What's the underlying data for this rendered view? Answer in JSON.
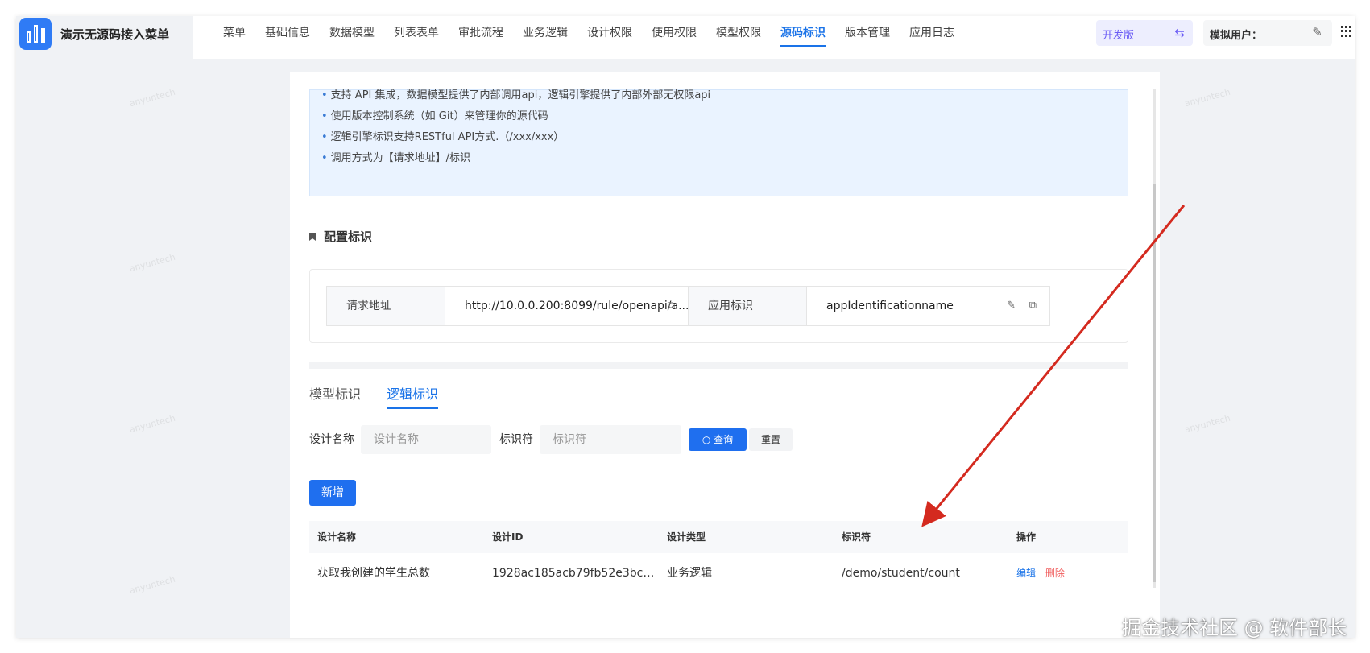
{
  "app": {
    "title": "演示无源码接入菜单"
  },
  "nav": [
    {
      "label": "菜单"
    },
    {
      "label": "基础信息"
    },
    {
      "label": "数据模型"
    },
    {
      "label": "列表表单"
    },
    {
      "label": "审批流程"
    },
    {
      "label": "业务逻辑"
    },
    {
      "label": "设计权限"
    },
    {
      "label": "使用权限"
    },
    {
      "label": "模型权限"
    },
    {
      "label": "源码标识"
    },
    {
      "label": "版本管理"
    },
    {
      "label": "应用日志"
    }
  ],
  "nav_active": "源码标识",
  "header": {
    "env": "开发版",
    "user_label": "模拟用户："
  },
  "info_lines": [
    "支持 API 集成，数据模型提供了内部调用api，逻辑引擎提供了内部外部无权限api",
    "使用版本控制系统（如 Git）来管理你的源代码",
    "逻辑引擎标识支持RESTful API方式.（/xxx/xxx）",
    "调用方式为【请求地址】/标识"
  ],
  "config": {
    "section_title": "配置标识",
    "request_url_label": "请求地址",
    "request_url_value": "http://10.0.0.200:8099/rule/openapi/a...",
    "app_id_label": "应用标识",
    "app_id_value": "appIdentificationname"
  },
  "tabs": [
    {
      "label": "模型标识"
    },
    {
      "label": "逻辑标识"
    }
  ],
  "tab_active": "逻辑标识",
  "search": {
    "design_name_label": "设计名称",
    "design_name_placeholder": "设计名称",
    "identifier_label": "标识符",
    "identifier_placeholder": "标识符",
    "query_label": "查询",
    "reset_label": "重置"
  },
  "add_label": "新增",
  "table": {
    "columns": [
      "设计名称",
      "设计ID",
      "设计类型",
      "标识符",
      "操作"
    ],
    "rows": [
      {
        "name": "获取我创建的学生总数",
        "id": "1928ac185acb79fb52e3bc6...",
        "type": "业务逻辑",
        "identifier": "/demo/student/count",
        "edit": "编辑",
        "delete": "删除"
      }
    ]
  },
  "watermark_text": "掘金技术社区 @ 软件部长",
  "colors": {
    "primary": "#1f6fef",
    "danger": "#f05a5a",
    "arrow": "#d42a1f",
    "env_text": "#6a5cf5"
  },
  "icons": [
    "logo-bars-icon",
    "swap-icon",
    "edit-icon",
    "grid-menu-icon",
    "bookmark-icon",
    "copy-icon",
    "search-icon"
  ]
}
